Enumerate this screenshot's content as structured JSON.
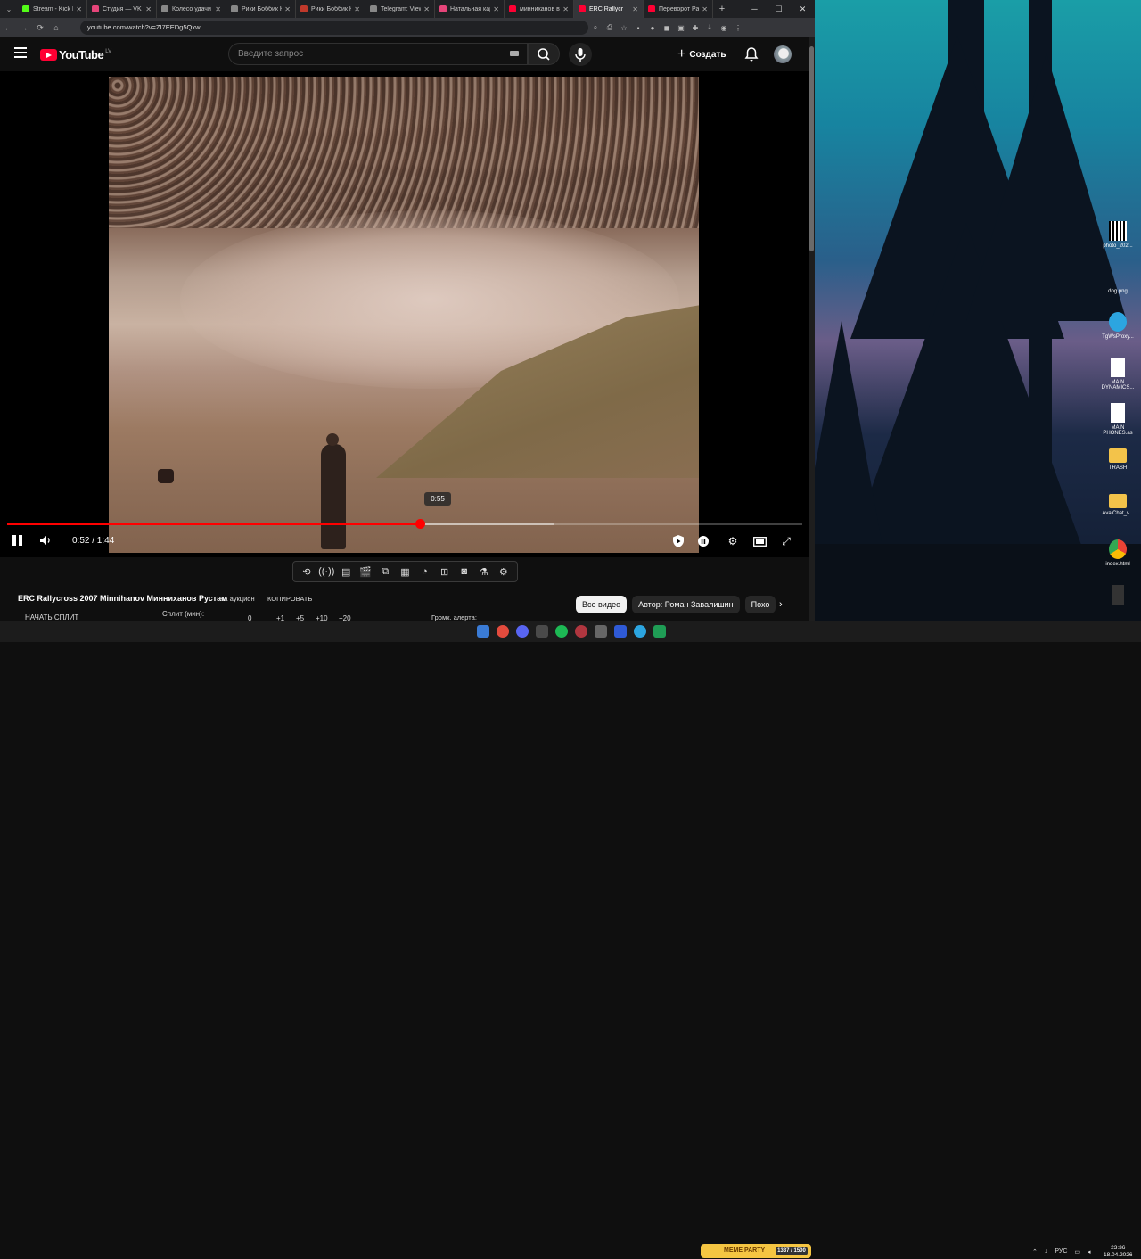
{
  "browser": {
    "tabs": [
      {
        "label": "Stream - Kick D",
        "color": "#53fc18",
        "active": false
      },
      {
        "label": "Студия — VK Е",
        "color": "#e6457a",
        "active": false
      },
      {
        "label": "Колесо удачи |",
        "color": "#888888",
        "active": false
      },
      {
        "label": "Рики Боббик К",
        "color": "#888888",
        "active": false
      },
      {
        "label": "Рики Боббик К",
        "color": "#c0392b",
        "active": false
      },
      {
        "label": "Telegram: View",
        "color": "#888888",
        "active": false
      },
      {
        "label": "Натальная кар",
        "color": "#e6457a",
        "active": false
      },
      {
        "label": "минниханов ва",
        "color": "#ff0033",
        "active": false
      },
      {
        "label": "ERC Rallycr",
        "color": "#ff0033",
        "active": true
      },
      {
        "label": "Переворот Ра",
        "color": "#ff0033",
        "active": false
      }
    ],
    "url": "youtube.com/watch?v=ZI7EEDg5Qxw"
  },
  "yt": {
    "logo": "YouTube",
    "country": "LV",
    "search_placeholder": "Введите запрос",
    "create_label": "Создать"
  },
  "player": {
    "time": "0:52 / 1:44",
    "tooltip_time": "0:55",
    "progress_played": 0.519,
    "progress_buffered": 0.688,
    "hover_position": 0.538
  },
  "below": {
    "title": "ERC Rallycross 2007 Minnihanov Минниханов Рустам",
    "auction": "На аукцион",
    "copy": "КОПИРОВАТЬ",
    "split_button": "НАЧАТЬ СПЛИТ",
    "split_label": "Сплит (мин):",
    "split_values": [
      "0",
      "+1",
      "+5",
      "+10",
      "+20"
    ],
    "alert_label": "Громк. алерта:",
    "chips": [
      "Все видео",
      "Автор: Роман Завалишин",
      "Похо"
    ]
  },
  "desktop": {
    "icons": [
      {
        "label": "photo_202...",
        "kind": "qr"
      },
      {
        "label": "dog.png",
        "kind": "img"
      },
      {
        "label": "TgWsProxy...",
        "kind": "tg"
      },
      {
        "label": "MAIN DYNAMICS...",
        "kind": "doc"
      },
      {
        "label": "MAIN PHONES.as",
        "kind": "doc"
      },
      {
        "label": "TRASH",
        "kind": "folder"
      },
      {
        "label": "AvalChat_v...",
        "kind": "folder"
      },
      {
        "label": "index.html",
        "kind": "chrome"
      },
      {
        "label": "",
        "kind": "dark"
      }
    ]
  },
  "taskbar": {
    "meme": "MEME PARTY",
    "meme_counter": "1337 / 1500",
    "lang": "РУС",
    "time": "23:36",
    "date": "18.04.2026"
  }
}
